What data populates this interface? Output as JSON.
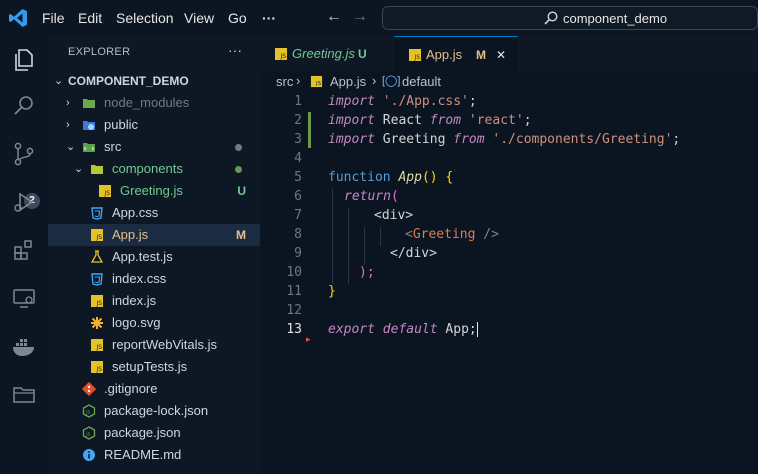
{
  "titlebar": {
    "menus": [
      "File",
      "Edit",
      "Selection",
      "View",
      "Go",
      "···"
    ],
    "search_text": "component_demo"
  },
  "activity": {
    "scm_badge": "2"
  },
  "explorer": {
    "title": "EXPLORER",
    "more": "···",
    "root": "COMPONENT_DEMO",
    "items": [
      {
        "label": "node_modules",
        "status": ""
      },
      {
        "label": "public",
        "status": ""
      },
      {
        "label": "src",
        "status": ""
      },
      {
        "label": "components",
        "status": ""
      },
      {
        "label": "Greeting.js",
        "status": "U"
      },
      {
        "label": "App.css",
        "status": ""
      },
      {
        "label": "App.js",
        "status": "M"
      },
      {
        "label": "App.test.js",
        "status": ""
      },
      {
        "label": "index.css",
        "status": ""
      },
      {
        "label": "index.js",
        "status": ""
      },
      {
        "label": "logo.svg",
        "status": ""
      },
      {
        "label": "reportWebVitals.js",
        "status": ""
      },
      {
        "label": "setupTests.js",
        "status": ""
      },
      {
        "label": ".gitignore",
        "status": ""
      },
      {
        "label": "package-lock.json",
        "status": ""
      },
      {
        "label": "package.json",
        "status": ""
      },
      {
        "label": "README.md",
        "status": ""
      }
    ]
  },
  "tabs": [
    {
      "label": "Greeting.js",
      "status": "U"
    },
    {
      "label": "App.js",
      "status": "M",
      "close": "✕"
    }
  ],
  "breadcrumb": {
    "folder": "src",
    "sep": "›",
    "file": "App.js",
    "symbol": "default"
  },
  "editor": {
    "line_numbers": [
      "1",
      "2",
      "3",
      "4",
      "5",
      "6",
      "7",
      "8",
      "9",
      "10",
      "11",
      "12",
      "13"
    ],
    "lines": [
      [
        "import",
        " './App.css'",
        ";"
      ],
      [
        "import",
        " React ",
        "from",
        " 'react'",
        ";"
      ],
      [
        "import",
        " Greeting ",
        "from",
        " './components/Greeting'",
        ";"
      ],
      [],
      [
        "function",
        " App",
        "()",
        " {"
      ],
      [
        "return",
        "("
      ],
      [
        "<div>"
      ],
      [
        "<",
        "Greeting",
        " />"
      ],
      [
        "</div>"
      ],
      [
        ");"
      ],
      [
        "}"
      ],
      [],
      [
        "export",
        " default",
        " App",
        ";"
      ]
    ]
  },
  "colors": {
    "accent_blue": "#007acc",
    "modified": "#e2c08d",
    "untracked": "#73c991",
    "sidebar_bg": "#0d1824"
  }
}
